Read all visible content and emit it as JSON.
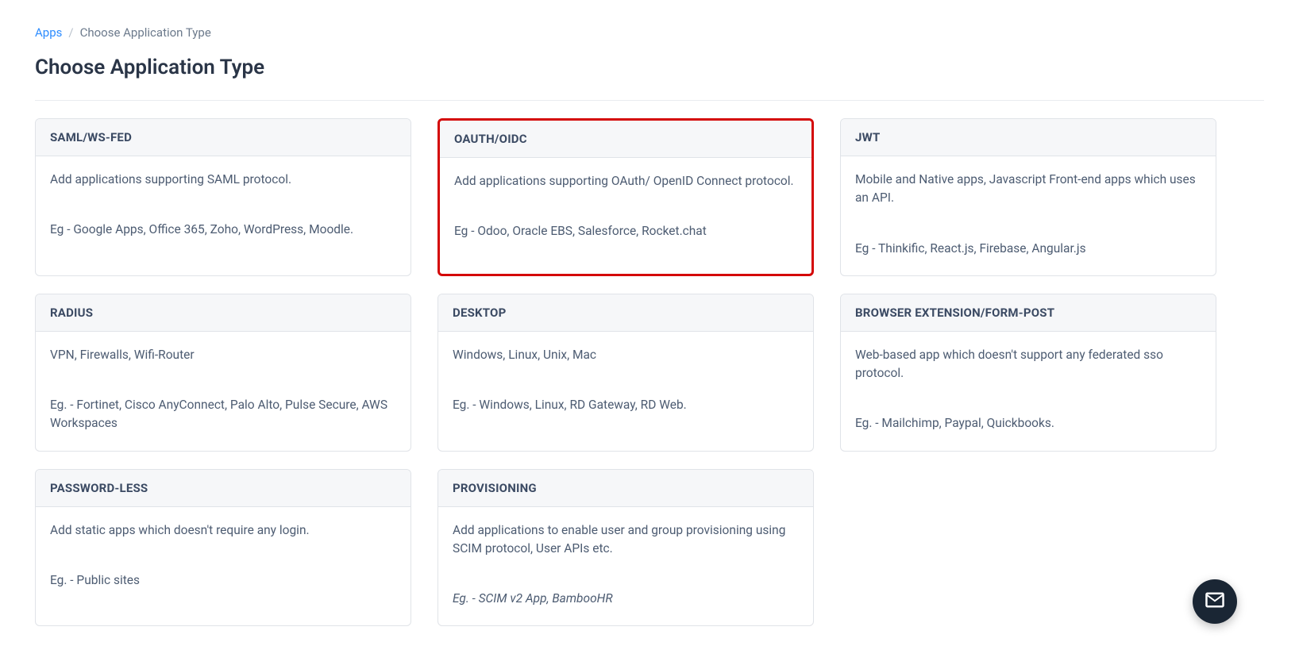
{
  "breadcrumb": {
    "link": "Apps",
    "separator": "/",
    "current": "Choose Application Type"
  },
  "page_title": "Choose Application Type",
  "cards": [
    {
      "title": "SAML/WS-FED",
      "description": "Add applications supporting SAML protocol.",
      "example": "Eg - Google Apps, Office 365, Zoho, WordPress, Moodle.",
      "highlighted": false,
      "italic_example": false
    },
    {
      "title": "OAUTH/OIDC",
      "description": "Add applications supporting OAuth/ OpenID Connect protocol.",
      "example": "Eg - Odoo, Oracle EBS, Salesforce, Rocket.chat",
      "highlighted": true,
      "italic_example": false
    },
    {
      "title": "JWT",
      "description": "Mobile and Native apps, Javascript Front-end apps which uses an API.",
      "example": "Eg - Thinkific, React.js, Firebase, Angular.js",
      "highlighted": false,
      "italic_example": false
    },
    {
      "title": "RADIUS",
      "description": "VPN, Firewalls, Wifi-Router",
      "example": "Eg. - Fortinet, Cisco AnyConnect, Palo Alto, Pulse Secure, AWS Workspaces",
      "highlighted": false,
      "italic_example": false
    },
    {
      "title": "DESKTOP",
      "description": "Windows, Linux, Unix, Mac",
      "example": "Eg. - Windows, Linux, RD Gateway, RD Web.",
      "highlighted": false,
      "italic_example": false
    },
    {
      "title": "BROWSER EXTENSION/FORM-POST",
      "description": "Web-based app which doesn't support any federated sso protocol.",
      "example": "Eg. - Mailchimp, Paypal, Quickbooks.",
      "highlighted": false,
      "italic_example": false
    },
    {
      "title": "PASSWORD-LESS",
      "description": "Add static apps which doesn't require any login.",
      "example": "Eg. - Public sites",
      "highlighted": false,
      "italic_example": false
    },
    {
      "title": "PROVISIONING",
      "description": "Add applications to enable user and group provisioning using SCIM protocol, User APIs etc.",
      "example": "Eg. - SCIM v2 App, BambooHR",
      "highlighted": false,
      "italic_example": true
    }
  ]
}
